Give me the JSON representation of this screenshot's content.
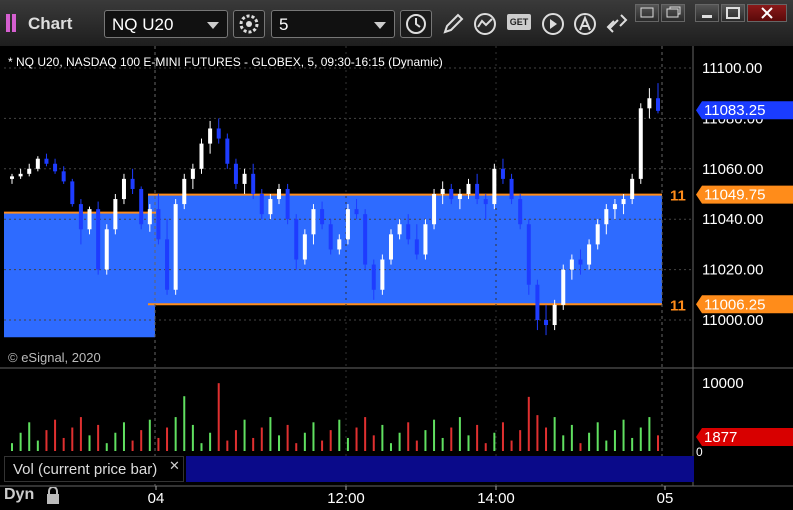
{
  "toolbar": {
    "app_title": "Chart",
    "symbol": "NQ U20",
    "interval": "5",
    "get_label": "GET"
  },
  "chart": {
    "header": "* NQ U20, NASDAQ 100 E-MINI FUTURES - GLOBEX, 5, 09:30-16:15 (Dynamic)",
    "copyright": "© eSignal, 2020",
    "price_axis_labels": [
      "11100.00",
      "11080.00",
      "11060.00",
      "11040.00",
      "11020.00",
      "11000.00"
    ],
    "price_badge": "11083.25",
    "upper_line_label": "11049.75",
    "lower_line_label": "11006.25",
    "line_tag": "11",
    "volume_axis_labels": [
      "10000",
      "0"
    ],
    "volume_badge": "1877",
    "study_label": "Vol (current price bar)",
    "time_labels": [
      "04",
      "12:00",
      "14:00",
      "05"
    ],
    "footer_label": "Dyn",
    "colors": {
      "up_candle": "#ffffff",
      "down_candle": "#1e3cff",
      "band_fill": "#2e6bff",
      "level_line": "#ff8c1a",
      "price_badge": "#1a3cff",
      "volume_badge": "#d80000",
      "vol_up": "#60e060",
      "vol_down": "#e03030"
    }
  },
  "chart_data": {
    "type": "candlestick",
    "symbol": "NQ U20",
    "interval": "5",
    "price_range": [
      10990,
      11105
    ],
    "levels": [
      11049.75,
      11006.25
    ],
    "last_price": 11083.25,
    "volume_range": [
      0,
      11500
    ],
    "last_volume": 1877,
    "bars": [
      [
        11056,
        11058,
        11054,
        11057
      ],
      [
        11057,
        11060,
        11056,
        11058
      ],
      [
        11058,
        11062,
        11057,
        11060
      ],
      [
        11060,
        11065,
        11059,
        11064
      ],
      [
        11064,
        11066,
        11061,
        11062
      ],
      [
        11062,
        11064,
        11058,
        11059
      ],
      [
        11059,
        11061,
        11054,
        11055
      ],
      [
        11055,
        11056,
        11045,
        11046
      ],
      [
        11046,
        11048,
        11030,
        11036
      ],
      [
        11036,
        11045,
        11034,
        11044
      ],
      [
        11044,
        11047,
        11018,
        11020
      ],
      [
        11020,
        11038,
        11018,
        11036
      ],
      [
        11036,
        11050,
        11034,
        11048
      ],
      [
        11048,
        11058,
        11046,
        11056
      ],
      [
        11056,
        11060,
        11050,
        11052
      ],
      [
        11052,
        11053,
        11036,
        11038
      ],
      [
        11038,
        11046,
        11035,
        11044
      ],
      [
        11044,
        11050,
        11030,
        11032
      ],
      [
        11032,
        11040,
        11010,
        11012
      ],
      [
        11012,
        11048,
        11010,
        11046
      ],
      [
        11046,
        11058,
        11044,
        11056
      ],
      [
        11056,
        11062,
        11052,
        11060
      ],
      [
        11060,
        11072,
        11058,
        11070
      ],
      [
        11070,
        11079,
        11066,
        11076
      ],
      [
        11076,
        11080,
        11070,
        11072
      ],
      [
        11072,
        11074,
        11060,
        11062
      ],
      [
        11062,
        11064,
        11052,
        11054
      ],
      [
        11054,
        11060,
        11050,
        11058
      ],
      [
        11058,
        11062,
        11048,
        11050
      ],
      [
        11050,
        11052,
        11040,
        11042
      ],
      [
        11042,
        11050,
        11040,
        11048
      ],
      [
        11048,
        11054,
        11046,
        11052
      ],
      [
        11052,
        11054,
        11038,
        11040
      ],
      [
        11040,
        11042,
        11020,
        11024
      ],
      [
        11024,
        11036,
        11022,
        11034
      ],
      [
        11034,
        11046,
        11030,
        11044
      ],
      [
        11044,
        11047,
        11036,
        11038
      ],
      [
        11038,
        11040,
        11026,
        11028
      ],
      [
        11028,
        11034,
        11026,
        11032
      ],
      [
        11032,
        11046,
        11030,
        11044
      ],
      [
        11044,
        11048,
        11040,
        11042
      ],
      [
        11042,
        11044,
        11020,
        11022
      ],
      [
        11022,
        11024,
        11008,
        11012
      ],
      [
        11012,
        11026,
        11010,
        11024
      ],
      [
        11024,
        11036,
        11022,
        11034
      ],
      [
        11034,
        11040,
        11032,
        11038
      ],
      [
        11038,
        11042,
        11030,
        11032
      ],
      [
        11032,
        11038,
        11024,
        11026
      ],
      [
        11026,
        11040,
        11024,
        11038
      ],
      [
        11038,
        11052,
        11036,
        11050
      ],
      [
        11050,
        11055,
        11046,
        11052
      ],
      [
        11052,
        11054,
        11046,
        11048
      ],
      [
        11048,
        11052,
        11044,
        11050
      ],
      [
        11050,
        11056,
        11048,
        11054
      ],
      [
        11054,
        11058,
        11046,
        11048
      ],
      [
        11048,
        11050,
        11040,
        11046
      ],
      [
        11046,
        11062,
        11044,
        11060
      ],
      [
        11060,
        11064,
        11054,
        11056
      ],
      [
        11056,
        11058,
        11046,
        11048
      ],
      [
        11048,
        11050,
        11036,
        11038
      ],
      [
        11038,
        11040,
        11010,
        11014
      ],
      [
        11014,
        11016,
        10996,
        11000
      ],
      [
        11000,
        11006,
        10994,
        10998
      ],
      [
        10998,
        11008,
        10996,
        11006
      ],
      [
        11006,
        11022,
        11004,
        11020
      ],
      [
        11020,
        11026,
        11016,
        11024
      ],
      [
        11024,
        11028,
        11018,
        11022
      ],
      [
        11022,
        11032,
        11020,
        11030
      ],
      [
        11030,
        11040,
        11028,
        11038
      ],
      [
        11038,
        11046,
        11034,
        11044
      ],
      [
        11044,
        11048,
        11040,
        11046
      ],
      [
        11046,
        11050,
        11042,
        11048
      ],
      [
        11048,
        11058,
        11046,
        11056
      ],
      [
        11056,
        11086,
        11054,
        11084
      ],
      [
        11084,
        11092,
        11080,
        11088
      ],
      [
        11088,
        11094,
        11082,
        11083
      ]
    ]
  }
}
